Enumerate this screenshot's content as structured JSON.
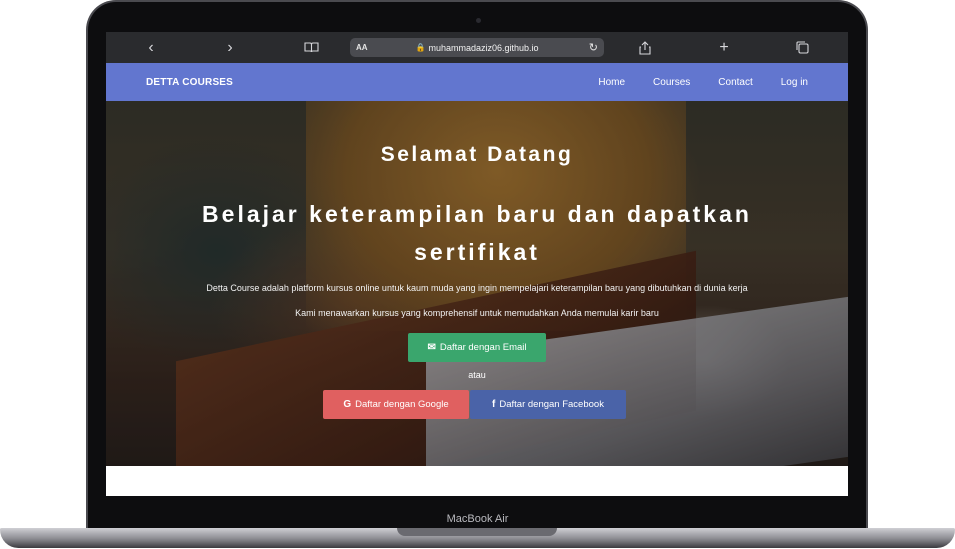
{
  "browser": {
    "back_icon": "chevron-left-icon",
    "forward_icon": "chevron-right-icon",
    "text_size": "AA",
    "url": "muhammadaziz06.github.io"
  },
  "site": {
    "brand": "DETTA COURSES",
    "nav": [
      "Home",
      "Courses",
      "Contact",
      "Log in"
    ]
  },
  "hero": {
    "welcome": "Selamat Datang",
    "headline": "Belajar keterampilan baru dan dapatkan sertifikat",
    "description_1": "Detta Course adalah platform kursus online untuk kaum muda yang ingin mempelajari keterampilan baru yang dibutuhkan di dunia kerja",
    "description_2": "Kami menawarkan kursus yang komprehensif untuk memudahkan Anda memulai karir baru",
    "email_button": "Daftar dengan Email",
    "or_text": "atau",
    "google_button": "Daftar dengan Google",
    "facebook_button": "Daftar dengan Facebook",
    "google_glyph": "G",
    "facebook_glyph": "f"
  },
  "device": {
    "label": "MacBook Air"
  },
  "colors": {
    "nav_bg": "#6276cf",
    "email_button": "#3aa66d",
    "google_button": "#e06060",
    "facebook_button": "#4a63a8"
  }
}
